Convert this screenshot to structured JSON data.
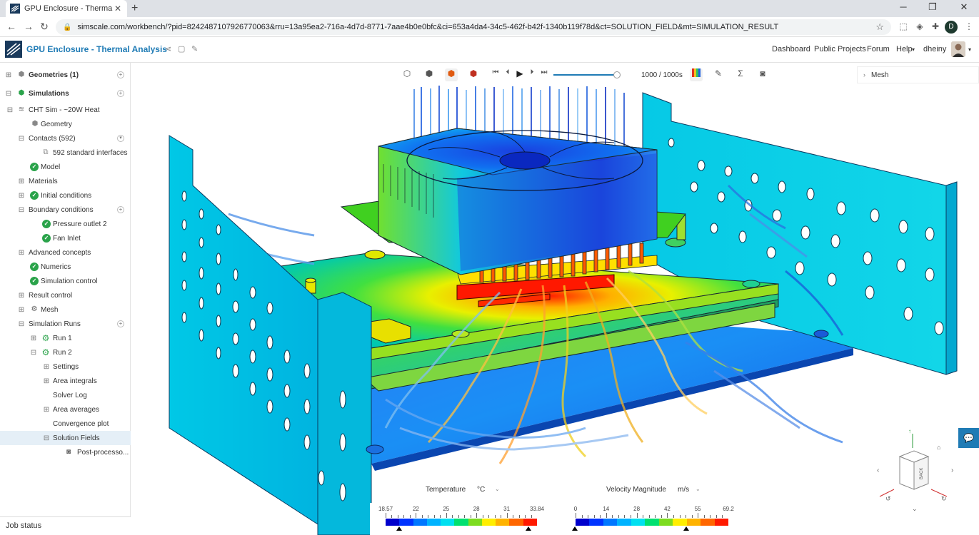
{
  "browser": {
    "tab_title": "GPU Enclosure - Thermal Analysis",
    "url": "simscale.com/workbench/?pid=8242487107926770063&rru=13a95ea2-716a-4d7d-8771-7aae4b0e0bfc&ci=653a4da4-34c5-462f-b42f-1340b119f78d&ct=SOLUTION_FIELD&mt=SIMULATION_RESULT",
    "profile_initial": "D"
  },
  "header": {
    "project_title": "GPU Enclosure - Thermal Analysis",
    "nav": [
      "Dashboard",
      "Public Projects",
      "Forum",
      "Help",
      "dheiny"
    ]
  },
  "sidebar": {
    "geometries": "Geometries (1)",
    "simulations": "Simulations",
    "items": [
      {
        "label": "CHT Sim - ~20W Heat"
      },
      {
        "label": "Geometry"
      },
      {
        "label": "Contacts (592)"
      },
      {
        "label": "592 standard interfaces"
      },
      {
        "label": "Model"
      },
      {
        "label": "Materials"
      },
      {
        "label": "Initial conditions"
      },
      {
        "label": "Boundary conditions"
      },
      {
        "label": "Pressure outlet 2"
      },
      {
        "label": "Fan Inlet"
      },
      {
        "label": "Advanced concepts"
      },
      {
        "label": "Numerics"
      },
      {
        "label": "Simulation control"
      },
      {
        "label": "Result control"
      },
      {
        "label": "Mesh"
      },
      {
        "label": "Simulation Runs"
      },
      {
        "label": "Run 1"
      },
      {
        "label": "Run 2"
      },
      {
        "label": "Settings"
      },
      {
        "label": "Area integrals"
      },
      {
        "label": "Solver Log"
      },
      {
        "label": "Area averages"
      },
      {
        "label": "Convergence plot"
      },
      {
        "label": "Solution Fields"
      },
      {
        "label": "Post-processo..."
      }
    ],
    "job_status": "Job status"
  },
  "viewer": {
    "time_display": "1000 / 1000s",
    "mesh_panel": "Mesh",
    "icons": [
      "cube-outline-icon",
      "cube-solid-icon",
      "cube-orange-icon",
      "cube-color-icon",
      "skip-start-icon",
      "step-back-icon",
      "play-icon",
      "step-forward-icon",
      "skip-end-icon",
      "legend-icon",
      "brush-icon",
      "sigma-icon",
      "camera-icon"
    ]
  },
  "legends": {
    "temperature": {
      "label": "Temperature",
      "unit": "°C",
      "ticks": [
        "18.57",
        "22",
        "25",
        "28",
        "31",
        "33.84"
      ],
      "colors": [
        "#0000cc",
        "#0033ff",
        "#0077ff",
        "#00b3ff",
        "#00e0f0",
        "#00e070",
        "#7ddc1f",
        "#ffee00",
        "#ffb300",
        "#ff6600",
        "#ff1a00"
      ]
    },
    "velocity": {
      "label": "Velocity Magnitude",
      "unit": "m/s",
      "ticks": [
        "0",
        "14",
        "28",
        "42",
        "55",
        "69.2"
      ],
      "colors": [
        "#0000cc",
        "#0033ff",
        "#0077ff",
        "#00b3ff",
        "#00e0f0",
        "#00e070",
        "#7ddc1f",
        "#ffee00",
        "#ffb300",
        "#ff6600",
        "#ff1a00"
      ]
    }
  },
  "view_cube": {
    "face": "BACK"
  }
}
